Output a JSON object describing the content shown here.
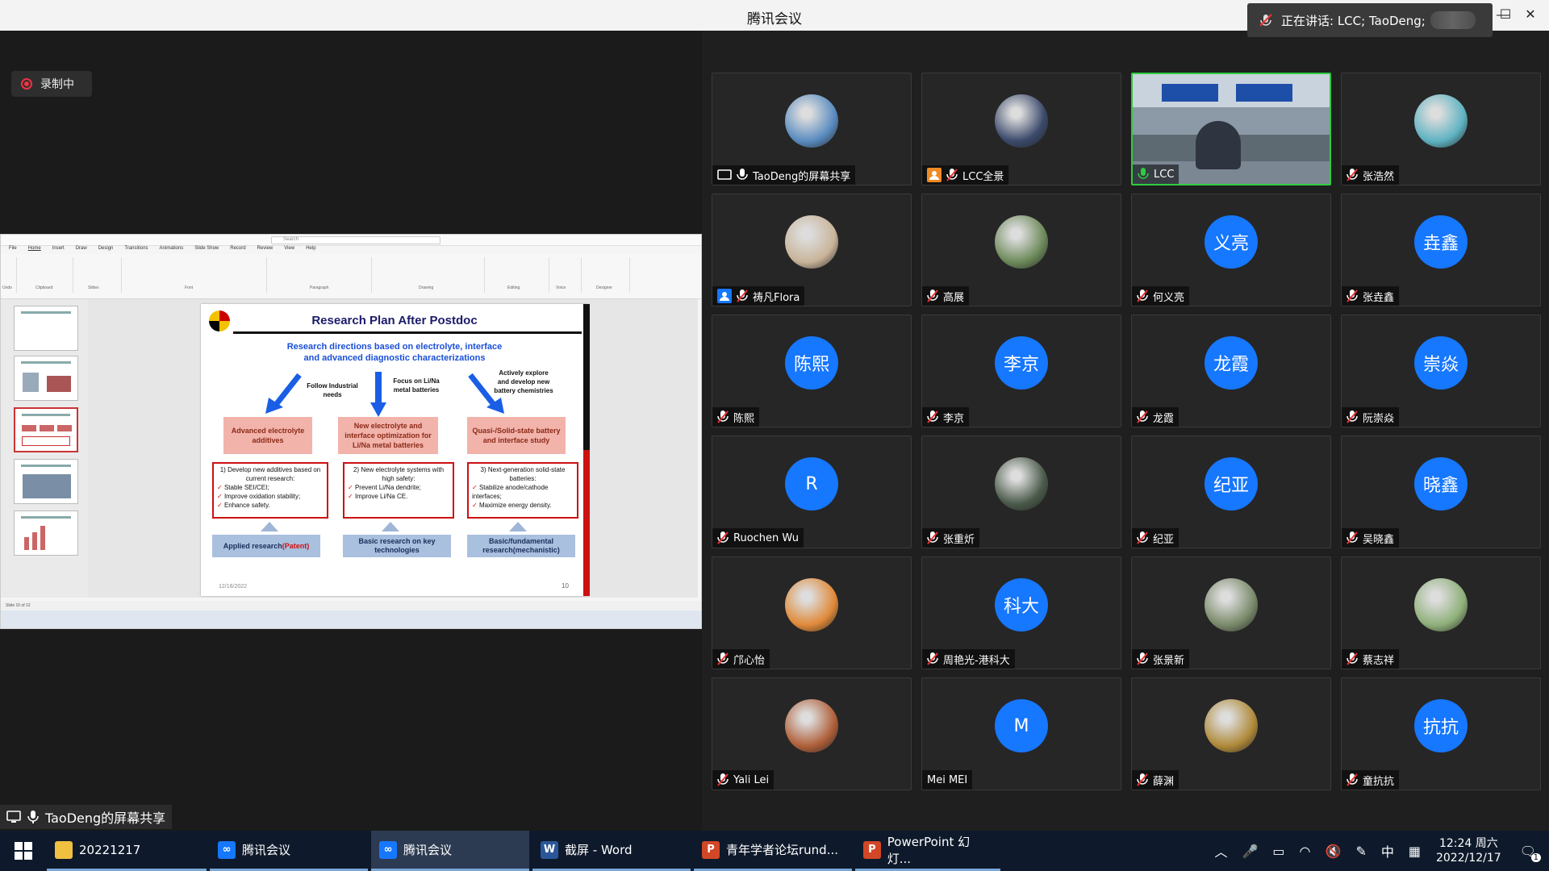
{
  "window": {
    "title": "腾讯会议",
    "speaking": "正在讲话: LCC; TaoDeng;"
  },
  "share": {
    "recording_label": "录制中",
    "sharer_label": "TaoDeng的屏幕共享"
  },
  "ppt": {
    "search_placeholder": "Search",
    "tabs": [
      "File",
      "Home",
      "Insert",
      "Draw",
      "Design",
      "Transitions",
      "Animations",
      "Slide Show",
      "Record",
      "Review",
      "View",
      "Help"
    ],
    "groups": [
      "Undo",
      "Clipboard",
      "Slides",
      "Font",
      "Paragraph",
      "Drawing",
      "Editing",
      "Voice",
      "Designer"
    ],
    "statusbar": "Slide 10 of 12",
    "slide": {
      "title": "Research Plan After Postdoc",
      "subtitle_1": "Research directions based on electrolyte, interface",
      "subtitle_2": "and advanced diagnostic characterizations",
      "arrow_labels": [
        "Follow Industrial needs",
        "Focus on Li/Na metal batteries",
        "Actively explore and develop new battery chemistries"
      ],
      "pink_boxes": [
        "Advanced electrolyte additives",
        "New electrolyte and interface optimization for Li/Na metal batteries",
        "Quasi-/Solid-state battery and interface study"
      ],
      "box1": {
        "head": "1) Develop new additives based on current research:",
        "items": [
          "Stable SEI/CEI;",
          "Improve oxidation stability;",
          "Enhance safety."
        ]
      },
      "box2": {
        "head": "2) New electrolyte systems with high safety:",
        "items": [
          "Prevent Li/Na dendrite;",
          "Improve Li/Na CE."
        ]
      },
      "box3": {
        "head": "3) Next-generation solid-state batteries:",
        "items": [
          "Stabilize anode/cathode interfaces;",
          "Maximize energy density."
        ]
      },
      "blue_boxes": {
        "b1_text": "Applied research ",
        "b1_red": "(Patent)",
        "b2": "Basic research on key technologies",
        "b3": "Basic/fundamental research(mechanistic)"
      },
      "date": "12/16/2022",
      "page": "10"
    }
  },
  "participants": [
    {
      "name": "TaoDeng的屏幕共享",
      "type": "photo",
      "avatar": "",
      "color": "#5a8cc0",
      "badge": "share",
      "mic": "on"
    },
    {
      "name": "LCC全景",
      "type": "photo",
      "avatar": "",
      "color": "#3b4a6b",
      "badge": "person-orange",
      "mic": "muted"
    },
    {
      "name": "LCC",
      "type": "video",
      "avatar": "",
      "color": "#8c9aa8",
      "badge": "",
      "mic": "active"
    },
    {
      "name": "张浩然",
      "type": "photo",
      "avatar": "",
      "color": "#5fb3c2",
      "badge": "",
      "mic": "muted"
    },
    {
      "name": "祷凡Flora",
      "type": "photo",
      "avatar": "",
      "color": "#c9b49a",
      "badge": "person-blue",
      "mic": "muted"
    },
    {
      "name": "高展",
      "type": "photo",
      "avatar": "",
      "color": "#6d8a5a",
      "badge": "",
      "mic": "muted"
    },
    {
      "name": "何义亮",
      "type": "text",
      "avatar": "义亮",
      "color": "#1677ff",
      "badge": "",
      "mic": "muted"
    },
    {
      "name": "张垚鑫",
      "type": "text",
      "avatar": "垚鑫",
      "color": "#1677ff",
      "badge": "",
      "mic": "muted"
    },
    {
      "name": "陈熙",
      "type": "text",
      "avatar": "陈熙",
      "color": "#1677ff",
      "badge": "",
      "mic": "muted"
    },
    {
      "name": "李京",
      "type": "text",
      "avatar": "李京",
      "color": "#1677ff",
      "badge": "",
      "mic": "muted"
    },
    {
      "name": "龙霞",
      "type": "text",
      "avatar": "龙霞",
      "color": "#1677ff",
      "badge": "",
      "mic": "muted"
    },
    {
      "name": "阮崇焱",
      "type": "text",
      "avatar": "崇焱",
      "color": "#1677ff",
      "badge": "",
      "mic": "muted"
    },
    {
      "name": "Ruochen Wu",
      "type": "text",
      "avatar": "R",
      "color": "#1677ff",
      "badge": "",
      "mic": "muted"
    },
    {
      "name": "张重炘",
      "type": "photo",
      "avatar": "",
      "color": "#4a5a4a",
      "badge": "",
      "mic": "muted"
    },
    {
      "name": "纪亚",
      "type": "text",
      "avatar": "纪亚",
      "color": "#1677ff",
      "badge": "",
      "mic": "muted"
    },
    {
      "name": "吴晓鑫",
      "type": "text",
      "avatar": "晓鑫",
      "color": "#1677ff",
      "badge": "",
      "mic": "muted"
    },
    {
      "name": "邝心怡",
      "type": "photo",
      "avatar": "",
      "color": "#e08a3a",
      "badge": "",
      "mic": "muted"
    },
    {
      "name": "周艳光-港科大",
      "type": "text",
      "avatar": "科大",
      "color": "#1677ff",
      "badge": "",
      "mic": "muted"
    },
    {
      "name": "张景新",
      "type": "photo",
      "avatar": "",
      "color": "#7a8a6a",
      "badge": "",
      "mic": "muted"
    },
    {
      "name": "蔡志祥",
      "type": "photo",
      "avatar": "",
      "color": "#8fb07a",
      "badge": "",
      "mic": "muted"
    },
    {
      "name": "Yali Lei",
      "type": "photo",
      "avatar": "",
      "color": "#b0603a",
      "badge": "",
      "mic": "muted"
    },
    {
      "name": "Mei MEI",
      "type": "text",
      "avatar": "M",
      "color": "#1677ff",
      "badge": "",
      "mic": "none"
    },
    {
      "name": "薛渊",
      "type": "photo",
      "avatar": "",
      "color": "#b08a3a",
      "badge": "",
      "mic": "muted"
    },
    {
      "name": "童抗抗",
      "type": "text",
      "avatar": "抗抗",
      "color": "#1677ff",
      "badge": "",
      "mic": "muted"
    }
  ],
  "taskbar": {
    "items": [
      {
        "label": "20221217",
        "icon": "folder-icon",
        "color": "#f0c040",
        "active": false
      },
      {
        "label": "腾讯会议",
        "icon": "tencent-meeting-icon",
        "color": "#1677ff",
        "active": false
      },
      {
        "label": "腾讯会议",
        "icon": "tencent-meeting-icon",
        "color": "#1677ff",
        "active": true
      },
      {
        "label": "截屏 - Word",
        "icon": "word-icon",
        "color": "#2b579a",
        "active": false
      },
      {
        "label": "青年学者论坛rund...",
        "icon": "powerpoint-icon",
        "color": "#d24726",
        "active": false
      },
      {
        "label": "PowerPoint 幻灯...",
        "icon": "powerpoint-icon",
        "color": "#d24726",
        "active": false
      }
    ],
    "ime": "中",
    "time": "12:24 周六",
    "date": "2022/12/17",
    "notifications": "1"
  }
}
